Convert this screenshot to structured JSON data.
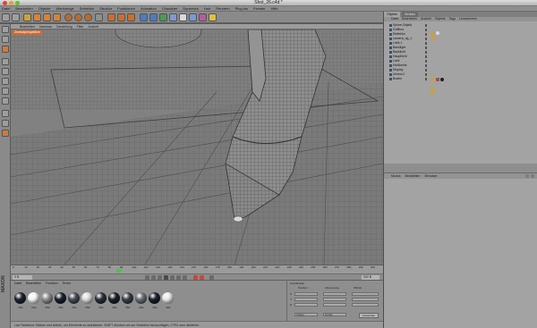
{
  "window": {
    "title": "Shot_26.c4d *"
  },
  "menubar": [
    "Datei",
    "Bearbeiten",
    "Objekte",
    "Werkzeuge",
    "Selektion",
    "Struktur",
    "Funktionen",
    "Animation",
    "Charakter",
    "Dynamics",
    "Hair",
    "Rendern",
    "Plug-ins",
    "Fenster",
    "Hilfe"
  ],
  "viewport": {
    "menu": [
      "Bearbeiten",
      "Kameras",
      "Darstellung",
      "Filter",
      "Ansicht"
    ],
    "label": "Zentralperspektive"
  },
  "timeline": {
    "ticks": [
      "0",
      "10",
      "20",
      "30",
      "40",
      "50",
      "60",
      "70",
      "80",
      "90",
      "100",
      "110",
      "120",
      "130",
      "140",
      "150",
      "160",
      "170",
      "180",
      "190",
      "200",
      "210",
      "220",
      "230",
      "240",
      "250",
      "260",
      "270",
      "280",
      "290",
      "300"
    ],
    "current_frame": "0 B",
    "end_frame": "300 B",
    "playhead_fraction": 0.29
  },
  "materials": {
    "menu": [
      "Datei",
      "Bearbeiten",
      "Funktion",
      "Textur"
    ],
    "items": [
      {
        "label": "Mat",
        "color": "#1d2230"
      },
      {
        "label": "Mat",
        "color": "#f2f2f2"
      },
      {
        "label": "Mat",
        "color": "#8c8c8c"
      },
      {
        "label": "Mat",
        "color": "#1a1f2e"
      },
      {
        "label": "Mat",
        "color": "#454a56"
      },
      {
        "label": "Mat",
        "color": "#d9d9d9"
      },
      {
        "label": "Mat",
        "color": "#2a2f3a"
      },
      {
        "label": "Mat",
        "color": "#1c2029"
      },
      {
        "label": "Mat",
        "color": "#3a3f4a"
      },
      {
        "label": "Mat",
        "color": "#6a6e76"
      },
      {
        "label": "Mat",
        "color": "#1a1e28"
      },
      {
        "label": "Mat",
        "color": "#e6e6e6"
      }
    ]
  },
  "coordinates": {
    "header": "Koordinaten",
    "rows": [
      "X",
      "Y",
      "Z"
    ],
    "cols": [
      "Position",
      "Abmessung",
      "Winkel"
    ],
    "dropdown_1": "Objekt",
    "dropdown_2": "Größe",
    "apply": "Anwenden"
  },
  "status": "Live Selektion: Klicken und ziehen, um Elemente zu selektieren. SHIFT drücken um zur Selektion hinzuzufügen, CTRL zum abziehen.",
  "object_manager": {
    "tabs": [
      "Objekte",
      "Struktur"
    ],
    "menu": [
      "Datei",
      "Bearbeiten",
      "Ansicht",
      "Objekte",
      "Tags",
      "Lesezeichen"
    ],
    "objects": [
      "Spline-Objekt",
      "Griffbox",
      "Reflektor",
      "camera_rig_1",
      "Licht.1",
      "Backlight",
      "Backlicht",
      "Hauptlicht",
      "Licht",
      "Hohlkehle",
      "Display",
      "Umzoo1",
      "Boden"
    ]
  },
  "attribute_manager": {
    "menu": [
      "Modus",
      "Bearbeiten",
      "Benutzer"
    ]
  },
  "colors": {
    "accent": "#d26a2d",
    "selection": "#3b4f72"
  }
}
